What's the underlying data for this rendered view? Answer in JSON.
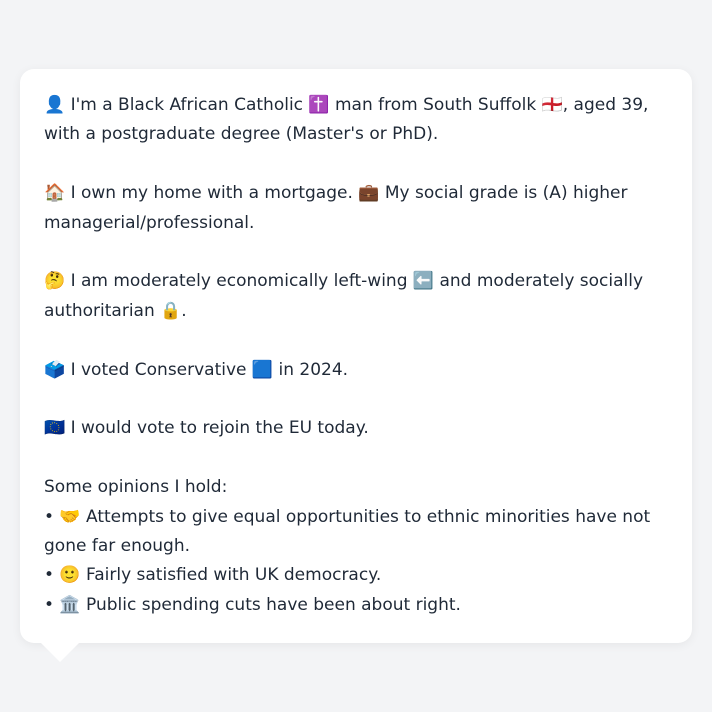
{
  "card": {
    "intro": "👤 I'm a Black African Catholic ✝️ man from South Suffolk 🏴󠁧󠁢󠁥󠁮󠁧󠁿, aged 39, with a postgraduate degree (Master's or PhD).",
    "housing": "🏠 I own my home with a mortgage. 💼 My social grade is (A) higher managerial/professional.",
    "ideology": "🤔 I am moderately economically left-wing ⬅️ and moderately socially authoritarian 🔒.",
    "vote": "🗳️ I voted Conservative 🟦 in 2024.",
    "eu": "🇪🇺 I would vote to rejoin the EU today.",
    "opinions_heading": "Some opinions I hold:",
    "opinions": [
      "• 🤝 Attempts to give equal opportunities to ethnic minorities have not gone far enough.",
      "• 🙂 Fairly satisfied with UK democracy.",
      "• 🏛️ Public spending cuts have been about right."
    ]
  }
}
